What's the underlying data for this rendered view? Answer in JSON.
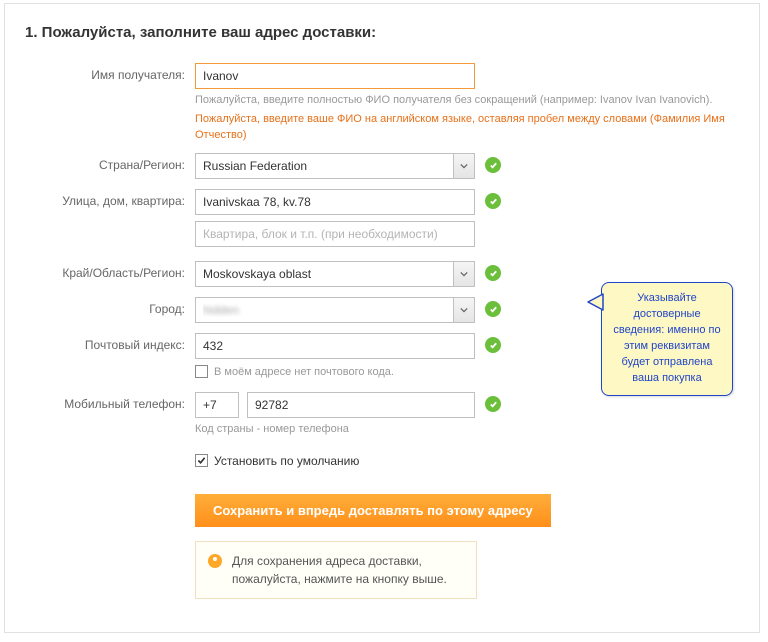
{
  "title": "1. Пожалуйста, заполните ваш адрес доставки:",
  "labels": {
    "name": "Имя получателя:",
    "country": "Страна/Регион:",
    "street": "Улица, дом, квартира:",
    "region": "Край/Область/Регион:",
    "city": "Город:",
    "zip": "Почтовый индекс:",
    "phone": "Мобильный телефон:"
  },
  "fields": {
    "name_value": "Ivanov",
    "name_hint1": "Пожалуйста, введите полностью ФИО получателя без сокращений (например: Ivanov Ivan Ivanovich).",
    "name_hint2": "Пожалуйста, введите ваше ФИО на английском языке, оставляя пробел между словами (Фамилия Имя Отчество)",
    "country_value": "Russian Federation",
    "street_value": "Ivanivskaa 78, kv.78",
    "street2_placeholder": "Квартира, блок и т.п. (при необходимости)",
    "region_value": "Moskovskaya oblast",
    "city_value": "",
    "zip_value": "432",
    "no_zip_label": "В моём адресе нет почтового кода.",
    "phone_cc": "+7",
    "phone_num": "92782",
    "phone_hint": "Код страны - номер телефона",
    "default_label": "Установить по умолчанию"
  },
  "actions": {
    "save": "Сохранить и впредь доставлять по этому адресу"
  },
  "tip": "Для сохранения адреса доставки, пожалуйста, нажмите на кнопку выше.",
  "callout": "Указывайте достоверные сведения: именно по этим реквизитам будет отправлена ваша покупка"
}
